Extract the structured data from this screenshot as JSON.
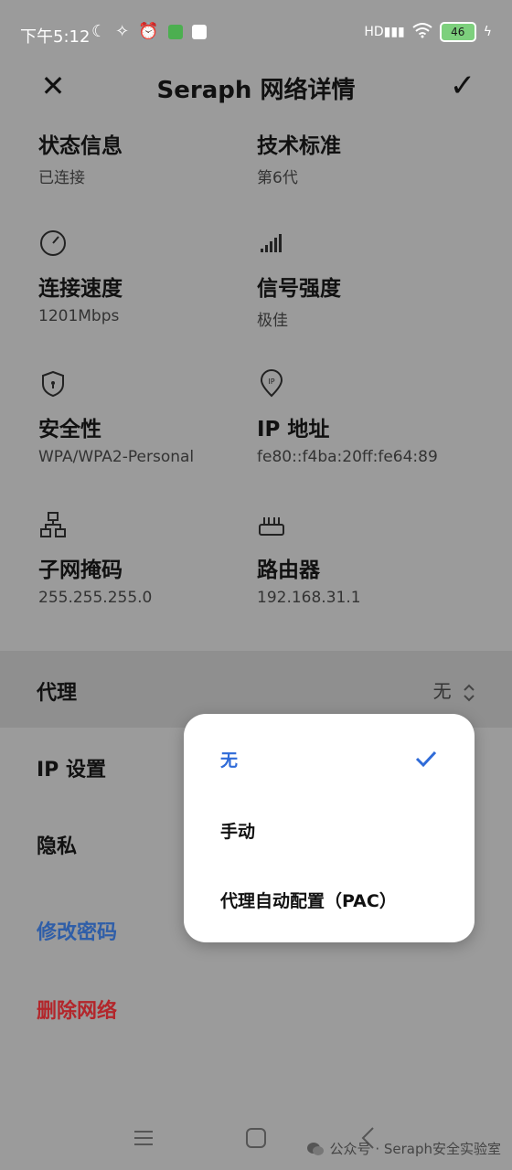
{
  "status_bar": {
    "time": "下午5:12",
    "battery": "46",
    "icons_left": [
      "moon-icon",
      "mute-icon",
      "alarm-icon",
      "app-notification-icon",
      "app-notification-icon"
    ],
    "icons_right": [
      "hd-signal-icon",
      "wifi-icon",
      "battery-icon",
      "charging-icon"
    ]
  },
  "header": {
    "title": "Seraph 网络详情",
    "close_symbol": "✕",
    "confirm_symbol": "✓"
  },
  "info": {
    "status": {
      "label": "状态信息",
      "value": "已连接"
    },
    "standard": {
      "label": "技术标准",
      "value": "第6代"
    },
    "speed": {
      "label": "连接速度",
      "value": "1201Mbps",
      "icon": "speedometer-icon"
    },
    "signal": {
      "label": "信号强度",
      "value": "极佳",
      "icon": "signal-bars-icon"
    },
    "security": {
      "label": "安全性",
      "value": "WPA/WPA2-Personal",
      "icon": "shield-icon"
    },
    "ip": {
      "label": "IP 地址",
      "value": "fe80::f4ba:20ff:fe64:89",
      "icon": "ip-pin-icon"
    },
    "subnet": {
      "label": "子网掩码",
      "value": "255.255.255.0",
      "icon": "network-tree-icon"
    },
    "router": {
      "label": "路由器",
      "value": "192.168.31.1",
      "icon": "router-icon"
    }
  },
  "rows": {
    "proxy": {
      "label": "代理",
      "value": "无"
    },
    "ip_settings": {
      "label": "IP 设置"
    },
    "privacy": {
      "label": "隐私"
    },
    "change_password": {
      "label": "修改密码"
    },
    "delete_network": {
      "label": "删除网络"
    }
  },
  "popup": {
    "options": [
      {
        "label": "无",
        "selected": true
      },
      {
        "label": "手动",
        "selected": false
      },
      {
        "label": "代理自动配置（PAC）",
        "selected": false
      }
    ]
  },
  "watermark": {
    "text": "公众号 · Seraph安全实验室"
  },
  "colors": {
    "accent": "#2f6bd8",
    "link_blue": "#2f5ea8",
    "danger_red": "#b3262b",
    "overlay_bg": "#9b9b9b"
  }
}
